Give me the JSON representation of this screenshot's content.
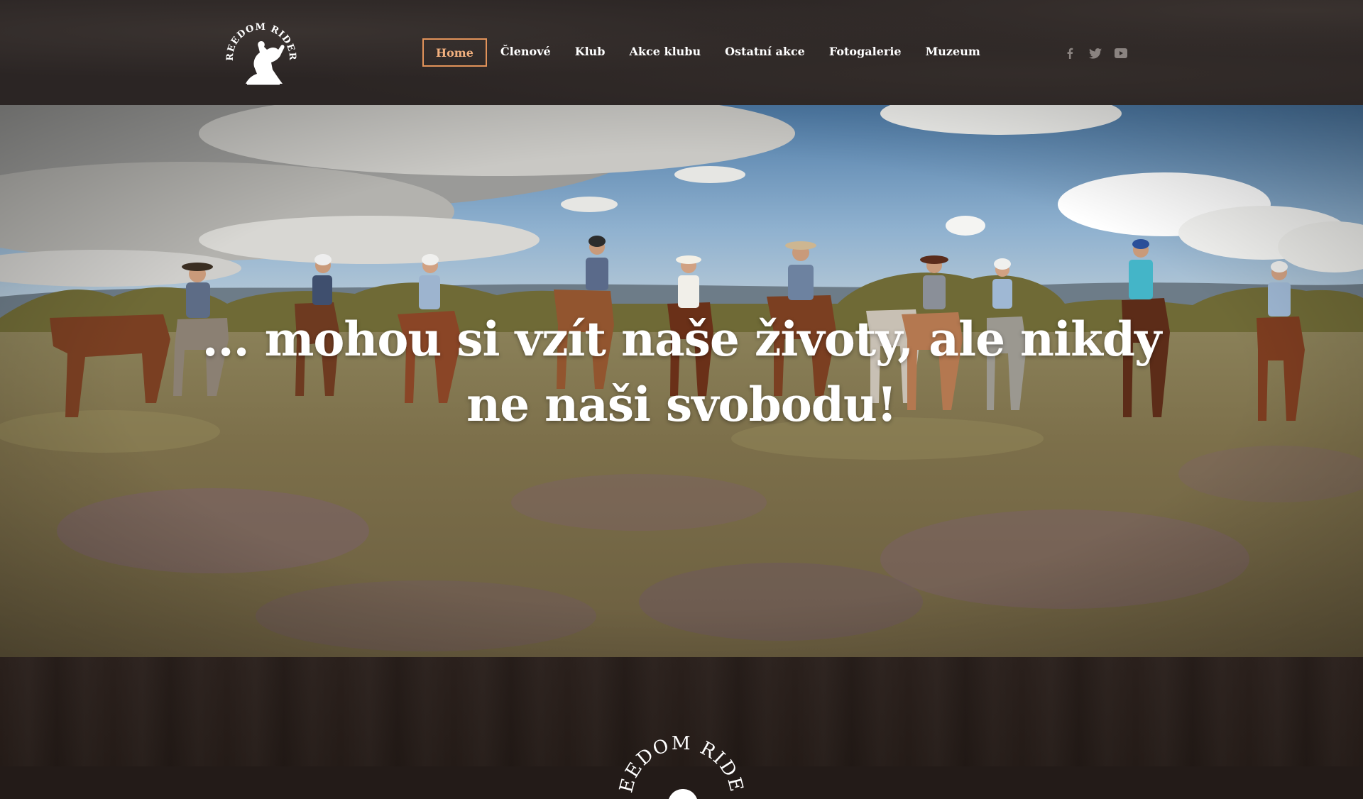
{
  "header": {
    "logo_text": "FREEDOM RIDERS",
    "nav": [
      {
        "label": "Home",
        "active": true
      },
      {
        "label": "Členové",
        "active": false
      },
      {
        "label": "Klub",
        "active": false
      },
      {
        "label": "Akce klubu",
        "active": false
      },
      {
        "label": "Ostatní akce",
        "active": false
      },
      {
        "label": "Fotogalerie",
        "active": false
      },
      {
        "label": "Muzeum",
        "active": false
      }
    ],
    "social": [
      "facebook-icon",
      "twitter-icon",
      "youtube-icon"
    ]
  },
  "hero": {
    "line1": "... mohou si vzít naše životy, ale nikdy",
    "line2": "ne naši svobodu!"
  },
  "footer": {
    "logo_text": "FREEDOM RIDERS"
  },
  "colors": {
    "header_bg": "#2b2524",
    "accent": "#e2935a",
    "wood_bg": "#241b17"
  }
}
